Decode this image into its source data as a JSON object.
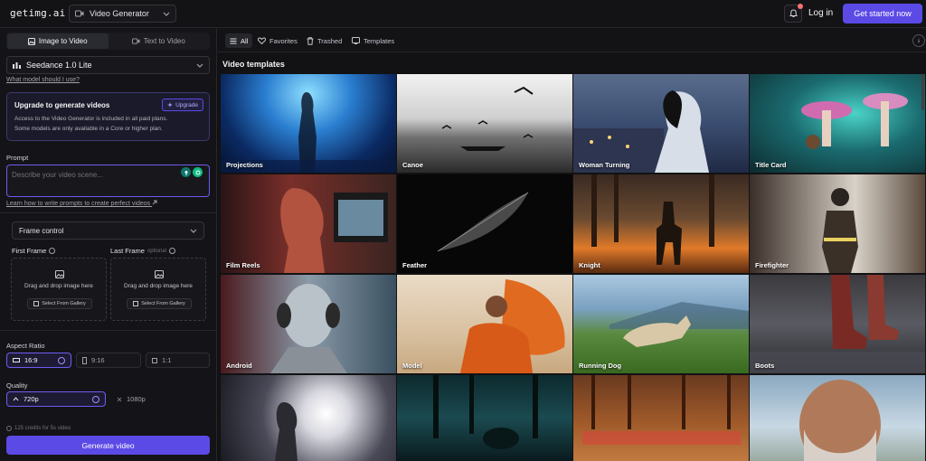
{
  "header": {
    "logo": "getimg.ai",
    "generator_label": "Video Generator",
    "login": "Log in",
    "cta": "Get started now"
  },
  "left": {
    "tabs": [
      {
        "label": "Image to Video",
        "active": true
      },
      {
        "label": "Text to Video",
        "active": false
      }
    ],
    "model": "Seedance 1.0 Lite",
    "model_help": "What model should I use?",
    "upgrade": {
      "title": "Upgrade to generate videos",
      "button": "Upgrade",
      "line1": "Access to the Video Generator is included in all paid plans.",
      "line2": "Some models are only available in a Core or higher plan."
    },
    "prompt": {
      "label": "Prompt",
      "placeholder": "Describe your video scene...",
      "learn": "Learn how to write prompts to create perfect videos"
    },
    "frame_control": "Frame control",
    "first_frame": {
      "label": "First Frame",
      "drop": "Drag and drop image here",
      "gallery": "Select From Gallery"
    },
    "last_frame": {
      "label": "Last Frame",
      "optional": "optional",
      "drop": "Drag and drop image here",
      "gallery": "Select From Gallery"
    },
    "aspect_ratio": {
      "label": "Aspect Ratio",
      "options": [
        "16:9",
        "9:16",
        "1:1"
      ],
      "selected": "16:9"
    },
    "quality": {
      "label": "Quality",
      "options": [
        "720p",
        "1080p"
      ],
      "selected": "720p"
    },
    "credits": "125 credits for 5s video",
    "generate": "Generate video"
  },
  "filters": [
    {
      "label": "All",
      "icon": "grid-icon",
      "active": true
    },
    {
      "label": "Favorites",
      "icon": "heart-icon",
      "active": false
    },
    {
      "label": "Trashed",
      "icon": "trash-icon",
      "active": false
    },
    {
      "label": "Templates",
      "icon": "templates-icon",
      "active": false
    }
  ],
  "templates": {
    "title": "Video templates",
    "items": [
      {
        "label": "Projections"
      },
      {
        "label": "Canoe"
      },
      {
        "label": "Woman Turning"
      },
      {
        "label": "Title Card"
      },
      {
        "label": "Film Reels"
      },
      {
        "label": "Feather"
      },
      {
        "label": "Knight"
      },
      {
        "label": "Firefighter"
      },
      {
        "label": "Android"
      },
      {
        "label": "Model"
      },
      {
        "label": "Running Dog"
      },
      {
        "label": "Boots"
      },
      {
        "label": ""
      },
      {
        "label": ""
      },
      {
        "label": ""
      },
      {
        "label": ""
      }
    ]
  },
  "colors": {
    "accent": "#5b4ae6",
    "focus": "#6d5cf0"
  }
}
